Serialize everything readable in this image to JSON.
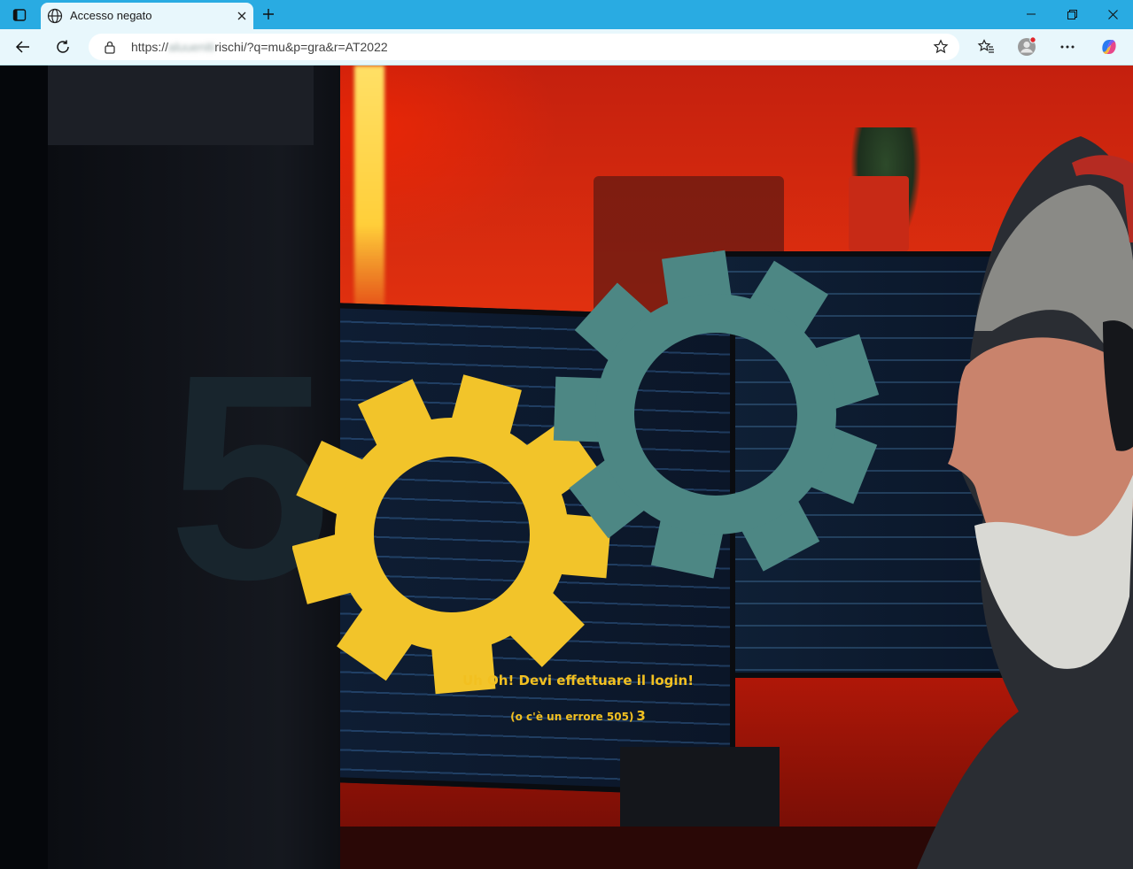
{
  "browser": {
    "tab": {
      "title": "Accesso negato",
      "icon": "globe-icon"
    },
    "address": {
      "scheme": "https://",
      "blurred_host": "aluueniti",
      "path": "rischi/?q=mu&p=gra&r=AT2022"
    },
    "accent": "#29abe2"
  },
  "error_page": {
    "digit": "5",
    "message": "Uh Oh! Devi effettuare il login!",
    "sub_message": "(o c'è un errore 505)",
    "badge": "3",
    "colors": {
      "digit": "#18252d",
      "gear_left": "#f2c42a",
      "gear_right": "#4d8784",
      "text": "#f2c021"
    }
  }
}
